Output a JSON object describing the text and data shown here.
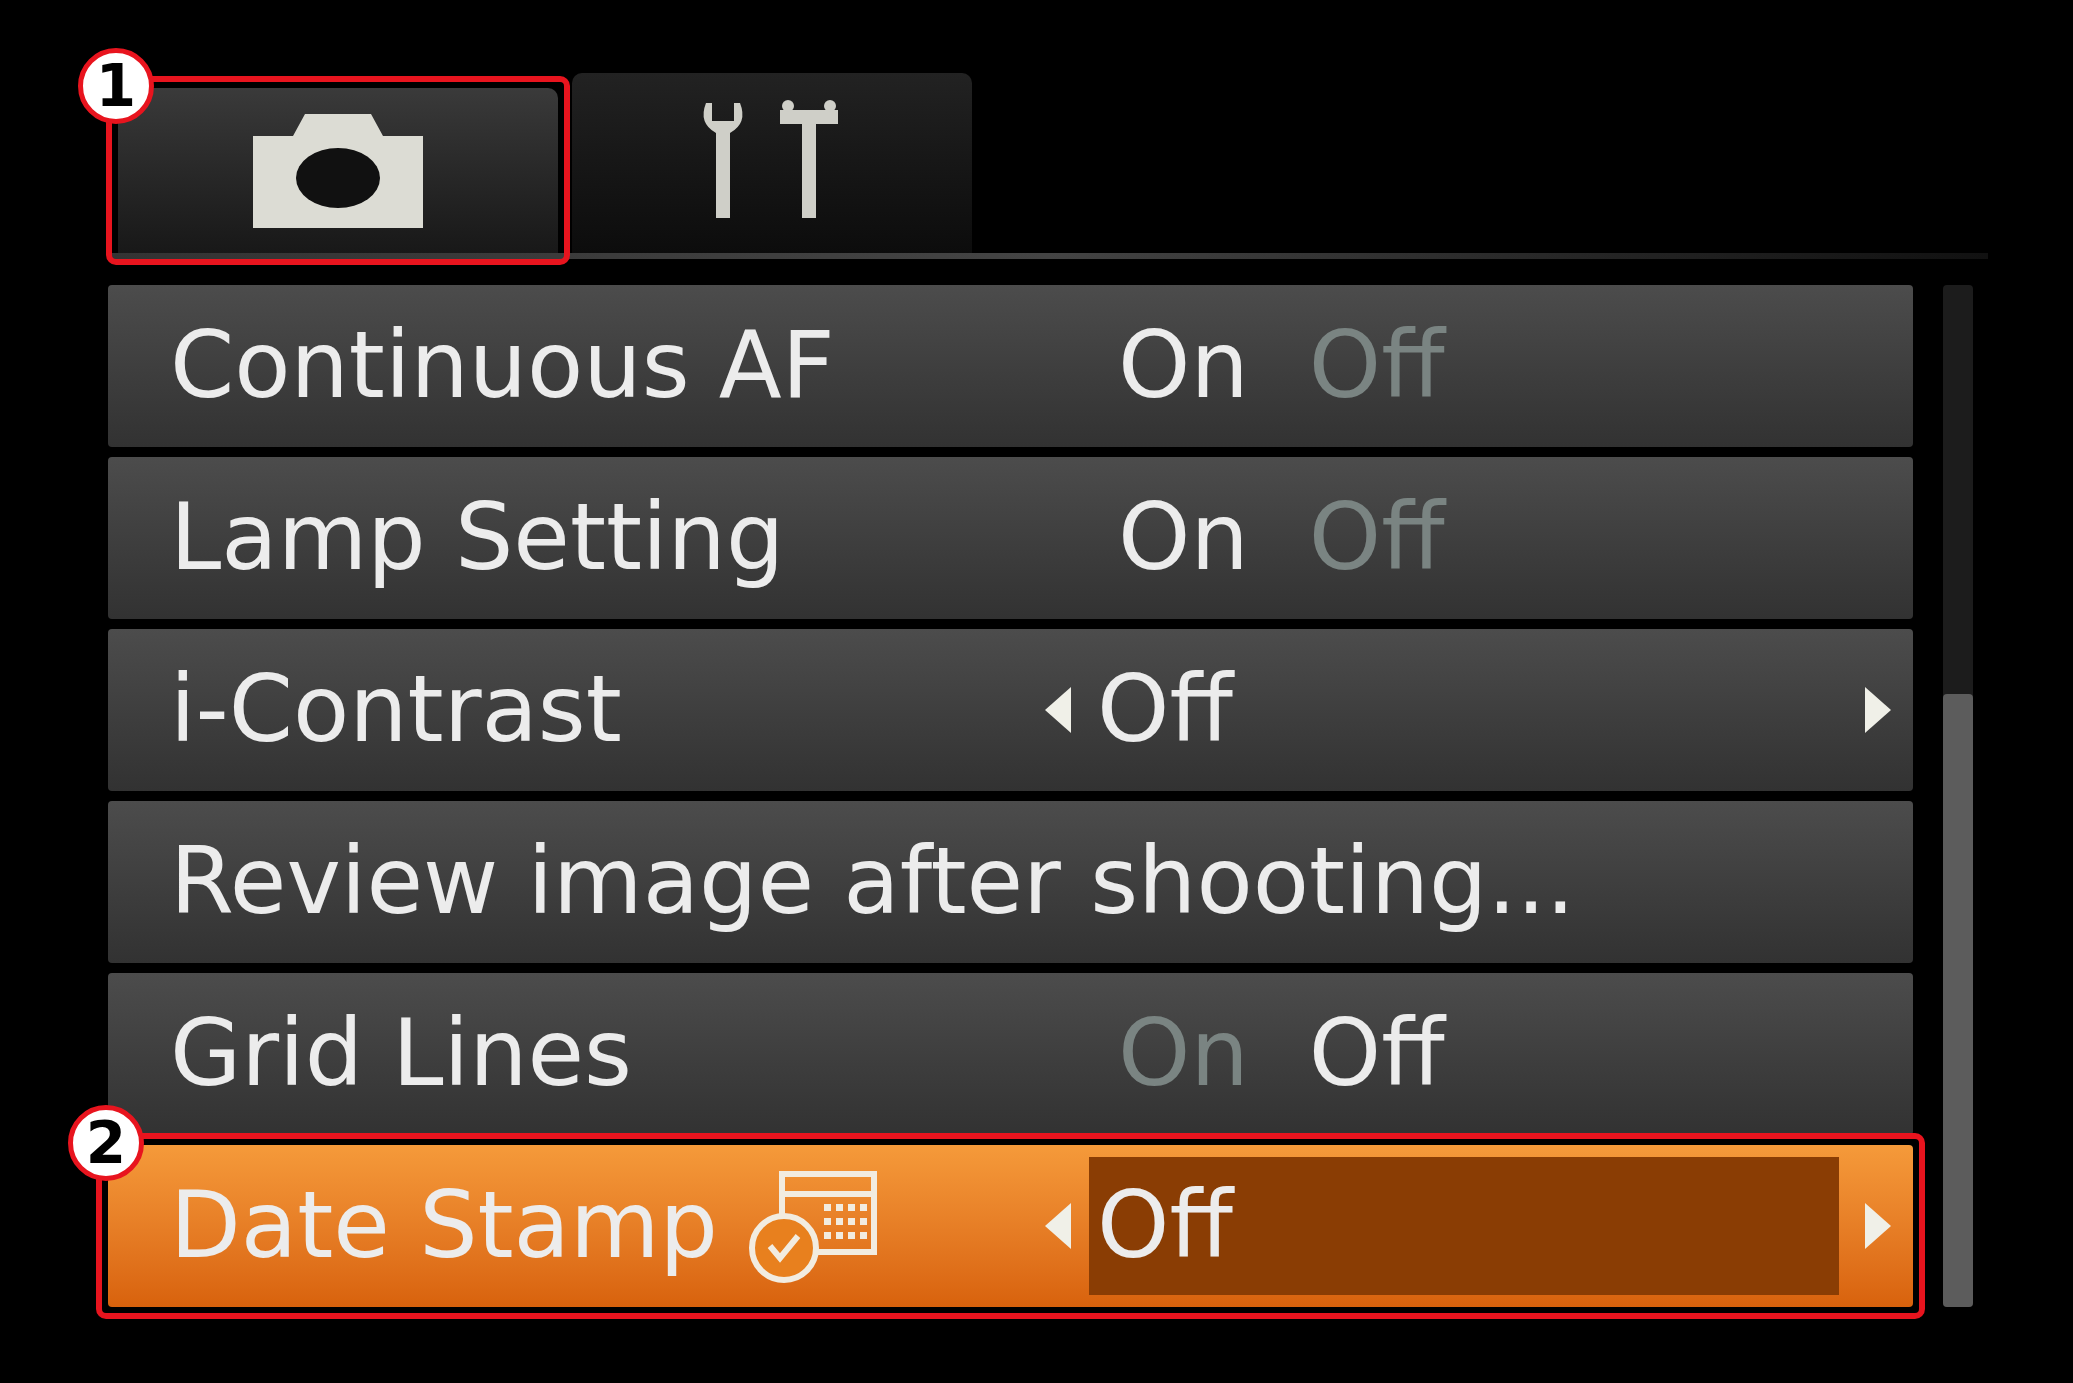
{
  "tabs": [
    {
      "kind": "camera",
      "selected": true,
      "callout": "1"
    },
    {
      "kind": "tools",
      "selected": false
    }
  ],
  "menu": {
    "items": [
      {
        "kind": "toggle",
        "label": "Continuous AF",
        "selected": false,
        "options": [
          {
            "label": "On",
            "selected": true
          },
          {
            "label": "Off",
            "selected": false
          }
        ]
      },
      {
        "kind": "toggle",
        "label": "Lamp Setting",
        "selected": false,
        "options": [
          {
            "label": "On",
            "selected": true
          },
          {
            "label": "Off",
            "selected": false
          }
        ]
      },
      {
        "kind": "select",
        "label": "i-Contrast",
        "selected": false,
        "value": "Off"
      },
      {
        "kind": "submenu",
        "label": "Review image after shooting...",
        "selected": false
      },
      {
        "kind": "toggle",
        "label": "Grid Lines",
        "selected": false,
        "options": [
          {
            "label": "On",
            "selected": false
          },
          {
            "label": "Off",
            "selected": true
          }
        ]
      },
      {
        "kind": "stamp",
        "label": "Date Stamp",
        "selected": true,
        "value": "Off",
        "callout": "2"
      }
    ]
  }
}
